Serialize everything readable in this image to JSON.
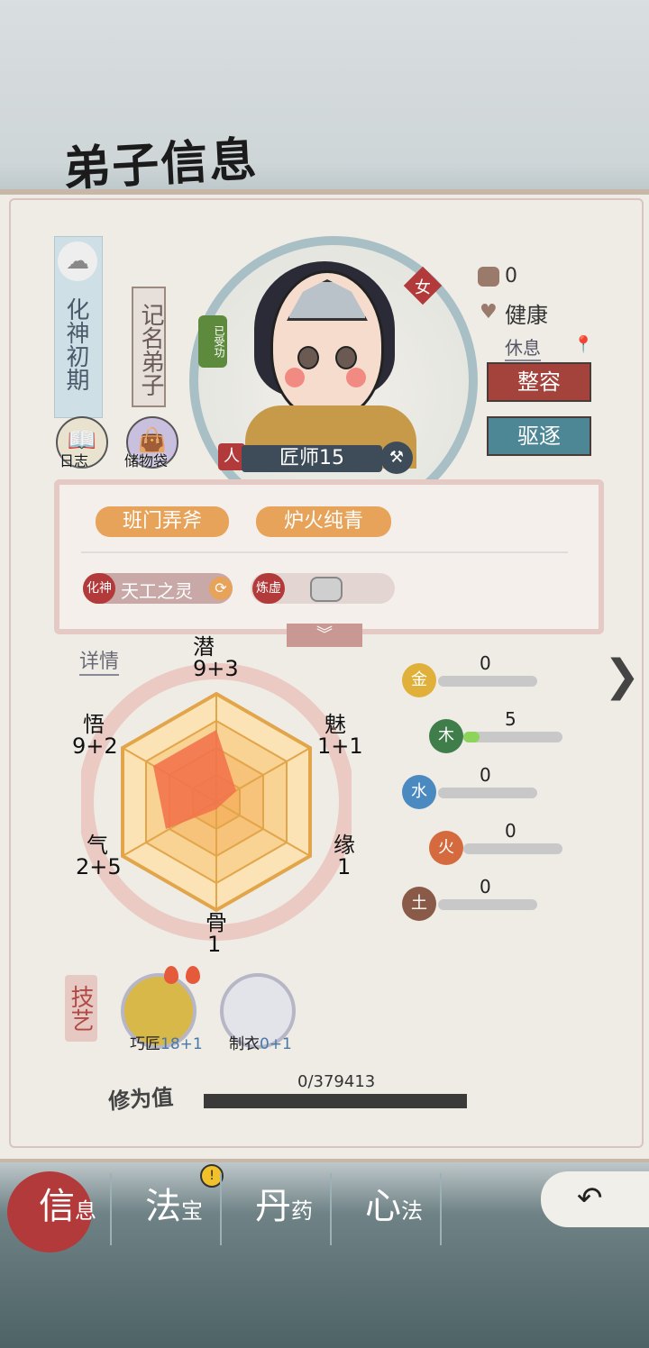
{
  "header": {
    "title": "弟子信息"
  },
  "disciple": {
    "realm": "化神初期",
    "rank": "记名弟子",
    "cultivated_tag": "已受功",
    "gender": "女",
    "race_badge": "人",
    "job": "匠师15"
  },
  "side_buttons": {
    "diary": "日志",
    "bag": "储物袋"
  },
  "status": {
    "mood_value": "0",
    "health": "健康",
    "activity": "休息",
    "makeover_label": "整容",
    "expel_label": "驱逐"
  },
  "traits": {
    "tag1": "班门弄斧",
    "tag2": "炉火纯青",
    "spirit_stage": "化神",
    "spirit_name": "天工之灵",
    "refine_stage": "炼虚"
  },
  "radar": {
    "details_label": "详情",
    "stats": [
      {
        "name": "潜",
        "value": "9+3"
      },
      {
        "name": "魅",
        "value": "1+1"
      },
      {
        "name": "缘",
        "value": "1"
      },
      {
        "name": "骨",
        "value": "1"
      },
      {
        "name": "气",
        "value": "2+5"
      },
      {
        "name": "悟",
        "value": "9+2"
      }
    ]
  },
  "elements": [
    {
      "name": "金",
      "value": "0",
      "color": "#e0b03a"
    },
    {
      "name": "木",
      "value": "5",
      "color": "#3f7e4a"
    },
    {
      "name": "水",
      "value": "0",
      "color": "#4a8ac0"
    },
    {
      "name": "火",
      "value": "0",
      "color": "#d56a3e"
    },
    {
      "name": "土",
      "value": "0",
      "color": "#8a5a48"
    }
  ],
  "element_max": 30,
  "skills": {
    "label": "技艺",
    "items": [
      {
        "name": "巧匠",
        "value": "18+1"
      },
      {
        "name": "制衣",
        "value": "0+1"
      }
    ]
  },
  "cultivation": {
    "label": "修为值",
    "progress": "0/379413"
  },
  "nav": {
    "tabs": [
      {
        "main": "信",
        "sub": "息"
      },
      {
        "main": "法",
        "sub": "宝"
      },
      {
        "main": "丹",
        "sub": "药"
      },
      {
        "main": "心",
        "sub": "法"
      }
    ],
    "alert": "!"
  },
  "colors": {
    "accent_red": "#b23a3a",
    "accent_teal": "#4d8694",
    "radar_fill": "#f2744d"
  }
}
